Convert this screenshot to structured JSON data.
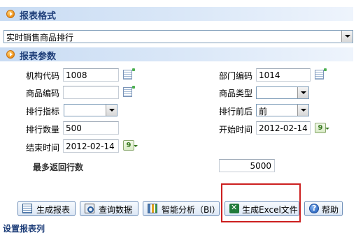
{
  "format_section": {
    "title": "报表格式",
    "report_select": "实时销售商品排行"
  },
  "params_section": {
    "title": "报表参数",
    "fields": {
      "org_code": {
        "label": "机构代码",
        "value": "1008"
      },
      "dept_code": {
        "label": "部门编码",
        "value": "1014"
      },
      "product_code": {
        "label": "商品编码",
        "value": ""
      },
      "product_type": {
        "label": "商品类型",
        "value": ""
      },
      "rank_index": {
        "label": "排行指标",
        "value": ""
      },
      "rank_order": {
        "label": "排行前后",
        "value": "前"
      },
      "rank_count": {
        "label": "排行数量",
        "value": "500"
      },
      "start_time": {
        "label": "开始时间",
        "value": "2012-02-14"
      },
      "end_time": {
        "label": "结束时间",
        "value": "2012-02-14"
      },
      "max_rows": {
        "label": "最多返回行数",
        "value": "5000"
      }
    },
    "calendar_icon_text": "9"
  },
  "buttons": {
    "generate_report": "生成报表",
    "query_data": "查询数据",
    "smart_analysis": "智能分析（BI）",
    "generate_excel": "生成Excel文件",
    "help": "帮助"
  },
  "footer": {
    "text": "设置报表列"
  },
  "colors": {
    "header_gradient": "#c9dcf3",
    "header_text": "#1f3f7a",
    "highlight_border": "#cc1f1f"
  }
}
